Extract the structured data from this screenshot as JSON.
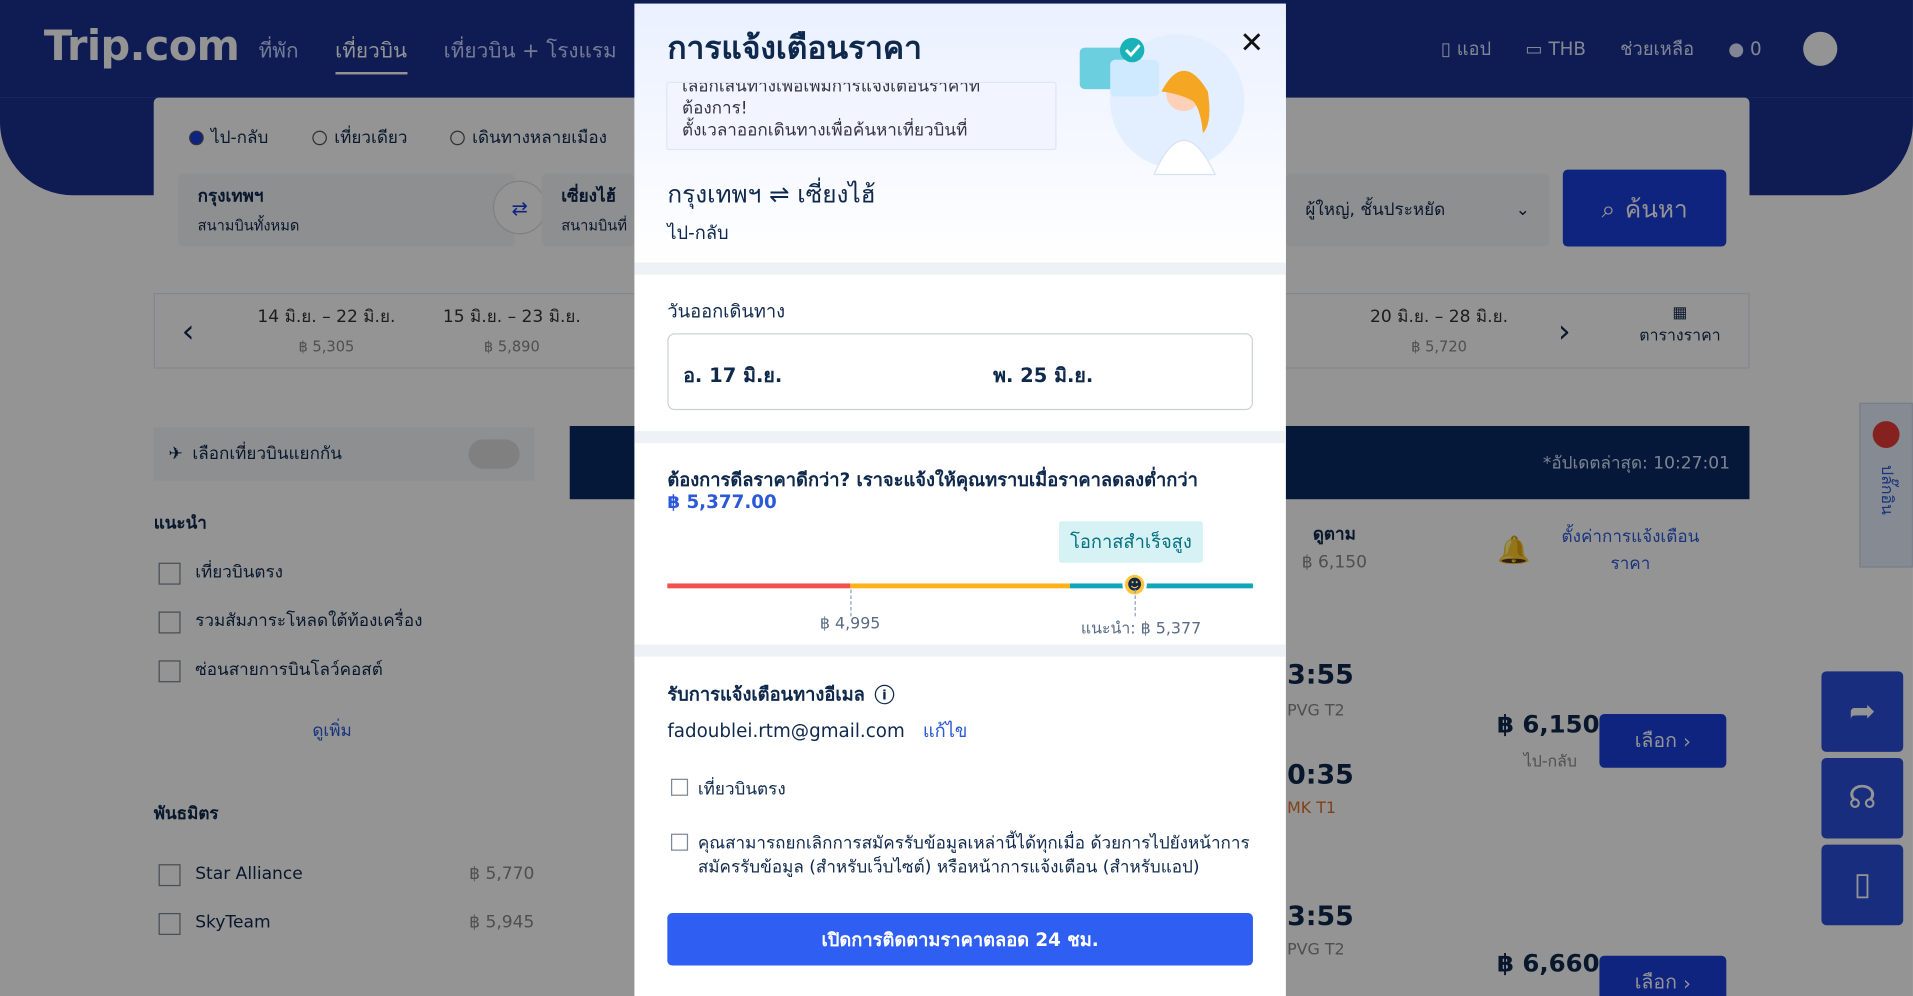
{
  "brand": "Trip.com",
  "nav": [
    "ที่พัก",
    "เที่ยวบิน",
    "เที่ยวบิน + โรงแรม"
  ],
  "header_right": {
    "app": "แอป",
    "currency": "THB",
    "help": "ช่วยเหลือ",
    "coins": "0"
  },
  "search": {
    "trip_types": [
      "ไป-กลับ",
      "เที่ยวเดียว",
      "เดินทางหลายเมือง"
    ],
    "from": {
      "city": "กรุงเทพฯ",
      "sub": "สนามบินทั้งหมด"
    },
    "to": {
      "city": "เซี่ยงไฮ้",
      "sub": "สนามบินที่"
    },
    "passengers": "ผู้ใหญ่, ชั้นประหยัด",
    "search_label": "ค้นหา"
  },
  "date_strip": [
    {
      "range": "14 มิ.ย. – 22 มิ.ย.",
      "price": "฿ 5,305"
    },
    {
      "range": "15 มิ.ย. – 23 มิ.ย.",
      "price": "฿ 5,890"
    },
    {
      "range": "20 มิ.ย. – 28 มิ.ย.",
      "price": "฿ 5,720"
    }
  ],
  "date_strip_table": "ตารางราคา",
  "filters": {
    "split_label": "เลือกเที่ยวบินแยกกัน",
    "recommended": "แนะนำ",
    "items": [
      "เที่ยวบินตรง",
      "รวมสัมภาระโหลดใต้ท้องเครื่อง",
      "ซ่อนสายการบินโลว์คอสต์"
    ],
    "more": "ดูเพิ่ม",
    "alliances_title": "พันธมิตร",
    "alliances": [
      {
        "name": "Star Alliance",
        "price": "฿ 5,770"
      },
      {
        "name": "SkyTeam",
        "price": "฿ 5,945"
      }
    ]
  },
  "results": {
    "updated": "*อัปเดตล่าสุด: 10:27:01",
    "col_label": "ดูตาม",
    "col_price": "฿ 6,150",
    "alert_setting": "ตั้งค่าการแจ้งเตือนราคา",
    "rows": [
      {
        "time1": "3:55",
        "apt1": "PVG T2",
        "time2": "0:35",
        "apt2": "MK T1",
        "price": "฿ 6,150",
        "sub": "ไป-กลับ",
        "btn": "เลือก"
      },
      {
        "time1": "3:55",
        "apt1": "PVG T2",
        "price": "฿ 6,660",
        "btn": "เลือก"
      }
    ]
  },
  "modal": {
    "title": "การแจ้งเตือนราคา",
    "tip_lines": [
      "เลือกเส้นทางเพื่อเพิ่มการแจ้งเตือนราคาที่",
      "ต้องการ!",
      "ตั้งเวลาออกเดินทางเพื่อค้นหาเที่ยวบินที่"
    ],
    "route": "กรุงเทพฯ ⇌ เซี่ยงไฮ้",
    "trip_type": "ไป-กลับ",
    "depart_label": "วันออกเดินทาง",
    "depart_date": "อ. 17 มิ.ย.",
    "return_date": "พ. 25 มิ.ย.",
    "question": "ต้องการดีลราคาดีกว่า? เราจะแจ้งให้คุณทราบเมื่อราคาลดลงต่ำกว่า",
    "target_price": "฿ 5,377.00",
    "chance_label": "โอกาสสำเร็จสูง",
    "scale_low": "฿ 4,995",
    "scale_recommended": "แนะนำ: ฿ 5,377",
    "email_label": "รับการแจ้งเตือนทางอีเมล",
    "email": "fadoublei.rtm@gmail.com",
    "edit": "แก้ไข",
    "checkbox_direct": "เที่ยวบินตรง",
    "checkbox_consent": "คุณสามารถยกเลิกการสมัครรับข้อมูลเหล่านี้ได้ทุกเมื่อ ด้วยการไปยังหน้าการสมัครรับข้อมูล (สำหรับเว็บไซต์) หรือหน้าการแจ้งเตือน (สำหรับแอป)",
    "cta": "เปิดการติดตามราคาตลอด 24 ชม.",
    "colors": {
      "red": "#f0514d",
      "orange": "#ffb21b",
      "teal": "#10a6b8",
      "blue": "#2e5ff2"
    }
  },
  "side_extension": "ปลั๊กอิน"
}
